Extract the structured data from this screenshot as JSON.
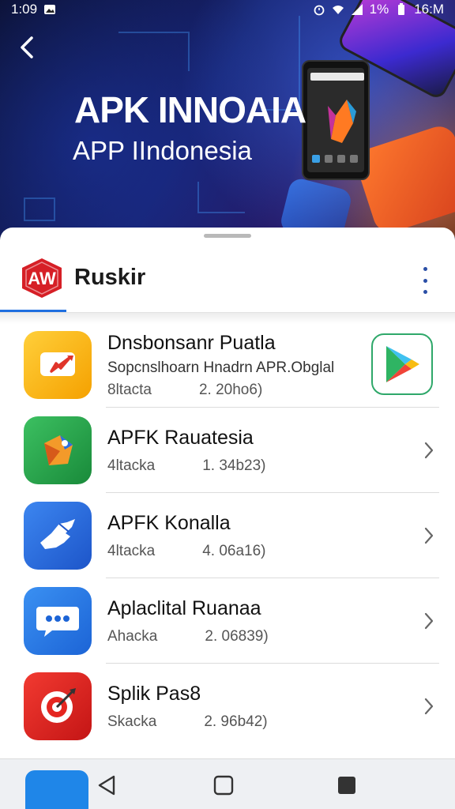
{
  "status_bar": {
    "time_left": "1:09",
    "battery": "1%",
    "time_right": "16:M"
  },
  "hero": {
    "title": "APK INNOAIA",
    "subtitle": "APP IIndonesia"
  },
  "header": {
    "brand_logo_text": "AW",
    "brand_name": "Ruskir"
  },
  "apps": [
    {
      "title": "Dnsbonsanr Puatla",
      "description": "Sopcnslhoarn Hnadrn APR.Obglal",
      "meta_label": "8ltacta",
      "meta_value": "2. 20ho6)",
      "icon": "flag-icon",
      "icon_color": "#f7b318",
      "action": "google-play-icon"
    },
    {
      "title": "APFK Rauatesia",
      "meta_label": "4ltacka",
      "meta_value": "1. 34b23)",
      "icon": "puzzle-icon",
      "icon_color": "#27a74a",
      "action": "chevron-right-icon"
    },
    {
      "title": "APFK Konalla",
      "meta_label": "4ltacka",
      "meta_value": "4. 06a16)",
      "icon": "hand-icon",
      "icon_color": "#2a6fe3",
      "action": "chevron-right-icon"
    },
    {
      "title": "Aplaclital Ruanaa",
      "meta_label": "Ahacka",
      "meta_value": "2. 06839)",
      "icon": "chat-bubble-icon",
      "icon_color": "#2a7fe6",
      "action": "chevron-right-icon"
    },
    {
      "title": "Splik Pas8",
      "meta_label": "Skacka",
      "meta_value": "2. 96b42)",
      "icon": "target-icon",
      "icon_color": "#e52620",
      "action": "chevron-right-icon"
    }
  ],
  "nav": {
    "back": "back-triangle-icon",
    "home": "home-square-icon",
    "recents": "recents-square-icon"
  }
}
